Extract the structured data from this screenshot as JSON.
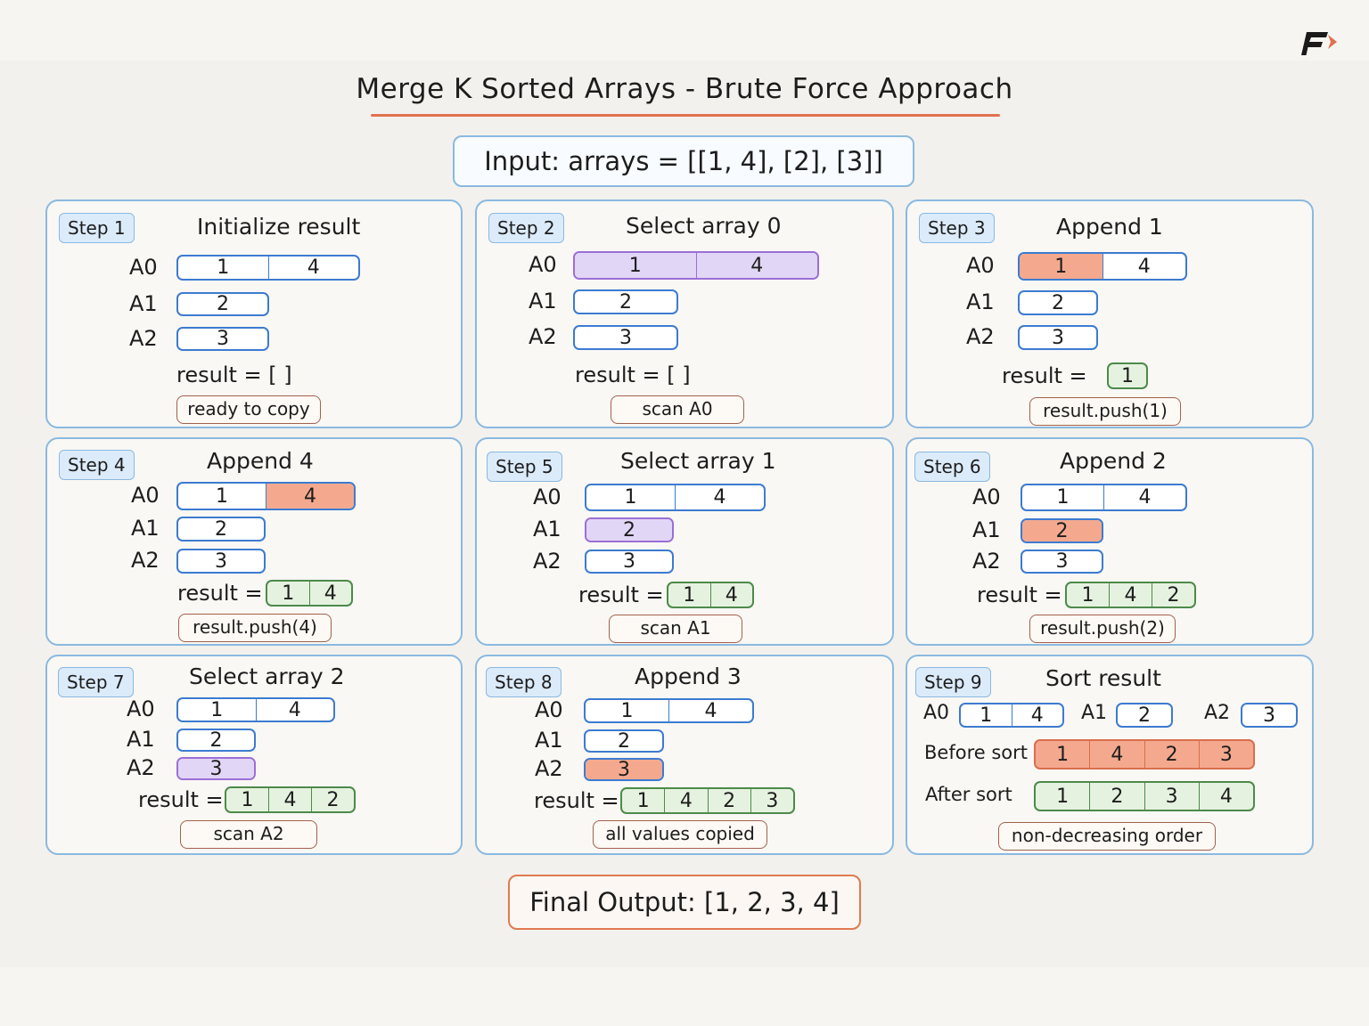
{
  "title": "Merge K Sorted Arrays - Brute Force Approach",
  "input": "Input: arrays = [[1, 4], [2], [3]]",
  "final_output": "Final Output: [1, 2, 3, 4]",
  "row_labels": {
    "a0": "A0",
    "a1": "A1",
    "a2": "A2",
    "result": "result =",
    "result_empty": "result = [ ]"
  },
  "colors": {
    "panel_border": "#8ab9e0",
    "array_border": "#3d7bd0",
    "select": "#e2d6f6",
    "append": "#f4a98e",
    "result": "#e6f2e0",
    "accent": "#e0714f"
  },
  "panels": [
    {
      "step": "Step 1",
      "title": "Initialize result",
      "a0": [
        "1",
        "4"
      ],
      "a1": [
        "2"
      ],
      "a2": [
        "3"
      ],
      "result": [],
      "note": "ready to copy"
    },
    {
      "step": "Step 2",
      "title": "Select array 0",
      "a0": [
        "1",
        "4"
      ],
      "a1": [
        "2"
      ],
      "a2": [
        "3"
      ],
      "result": [],
      "note": "scan A0"
    },
    {
      "step": "Step 3",
      "title": "Append 1",
      "a0": [
        "1",
        "4"
      ],
      "a1": [
        "2"
      ],
      "a2": [
        "3"
      ],
      "result": [
        "1"
      ],
      "note": "result.push(1)"
    },
    {
      "step": "Step 4",
      "title": "Append 4",
      "a0": [
        "1",
        "4"
      ],
      "a1": [
        "2"
      ],
      "a2": [
        "3"
      ],
      "result": [
        "1",
        "4"
      ],
      "note": "result.push(4)"
    },
    {
      "step": "Step 5",
      "title": "Select array 1",
      "a0": [
        "1",
        "4"
      ],
      "a1": [
        "2"
      ],
      "a2": [
        "3"
      ],
      "result": [
        "1",
        "4"
      ],
      "note": "scan A1"
    },
    {
      "step": "Step 6",
      "title": "Append 2",
      "a0": [
        "1",
        "4"
      ],
      "a1": [
        "2"
      ],
      "a2": [
        "3"
      ],
      "result": [
        "1",
        "4",
        "2"
      ],
      "note": "result.push(2)"
    },
    {
      "step": "Step 7",
      "title": "Select array 2",
      "a0": [
        "1",
        "4"
      ],
      "a1": [
        "2"
      ],
      "a2": [
        "3"
      ],
      "result": [
        "1",
        "4",
        "2"
      ],
      "note": "scan A2"
    },
    {
      "step": "Step 8",
      "title": "Append 3",
      "a0": [
        "1",
        "4"
      ],
      "a1": [
        "2"
      ],
      "a2": [
        "3"
      ],
      "result": [
        "1",
        "4",
        "2",
        "3"
      ],
      "note": "all values copied"
    }
  ],
  "step9": {
    "step": "Step 9",
    "title": "Sort result",
    "a0": [
      "1",
      "4"
    ],
    "a1": [
      "2"
    ],
    "a2": [
      "3"
    ],
    "before_label": "Before sort",
    "before": [
      "1",
      "4",
      "2",
      "3"
    ],
    "after_label": "After sort",
    "after": [
      "1",
      "2",
      "3",
      "4"
    ],
    "note": "non-decreasing order"
  }
}
